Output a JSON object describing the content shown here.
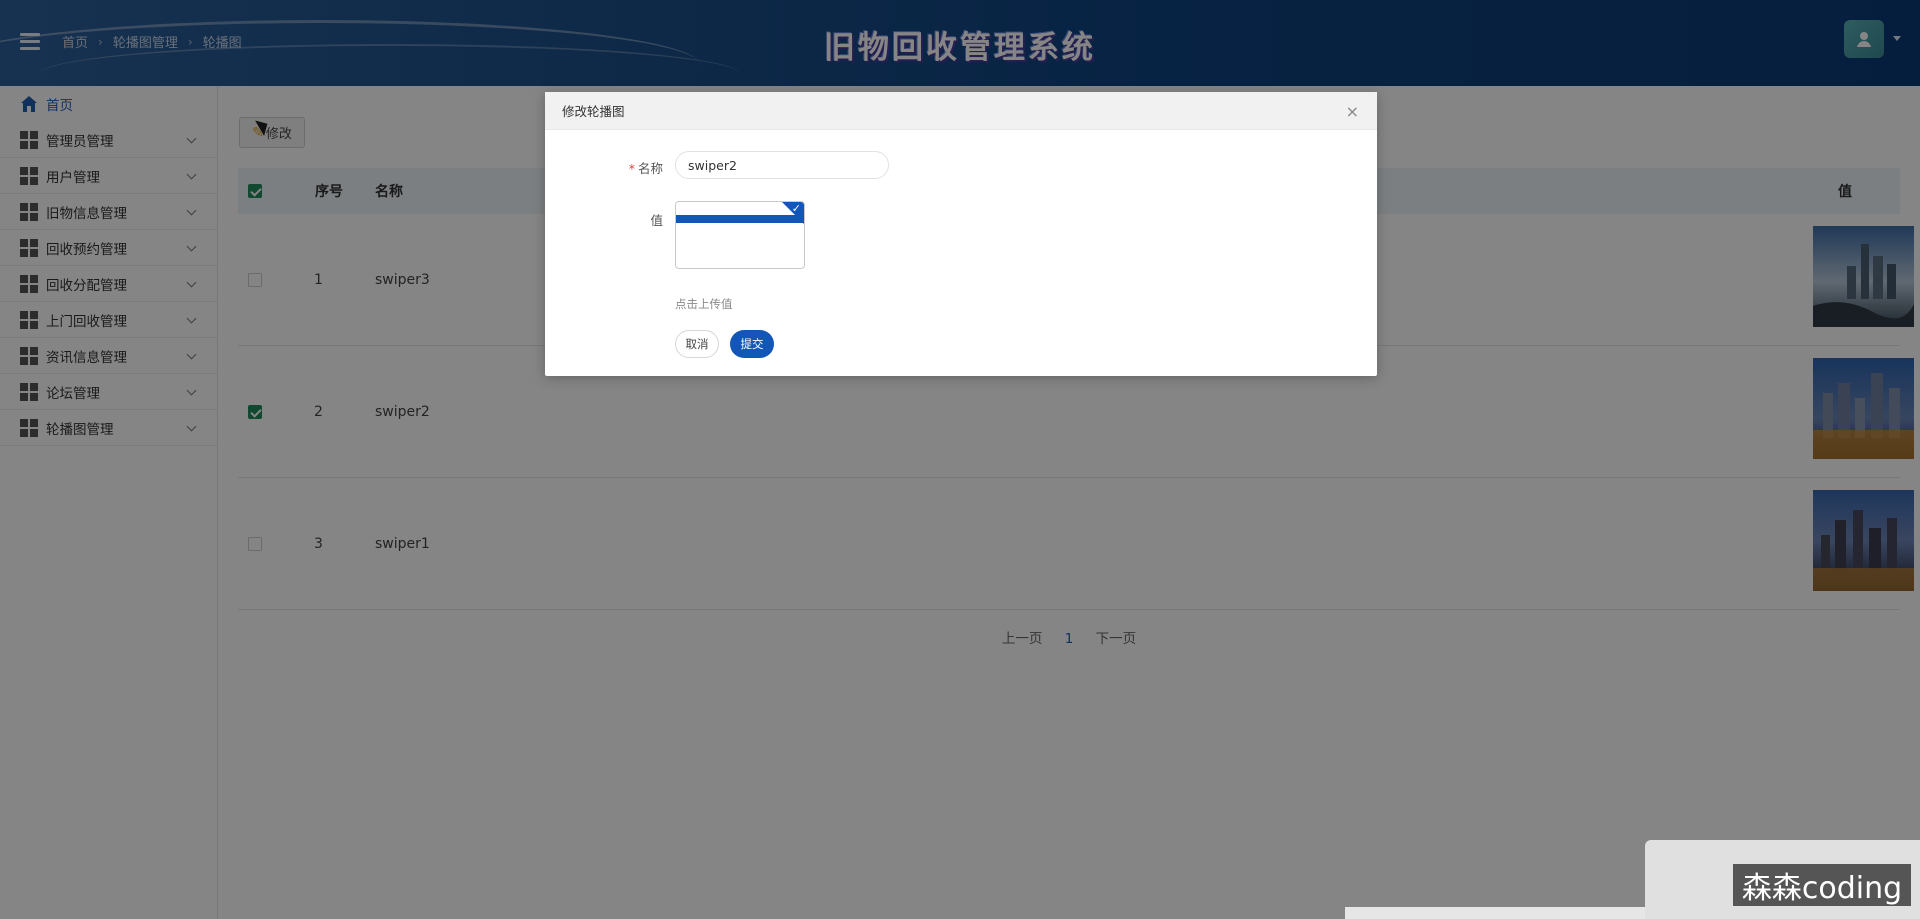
{
  "header": {
    "title": "旧物回收管理系统",
    "breadcrumb": [
      "首页",
      "轮播图管理",
      "轮播图"
    ]
  },
  "sidebar": {
    "items": [
      {
        "label": "首页",
        "icon": "home-icon",
        "expandable": false
      },
      {
        "label": "管理员管理",
        "icon": "grid-icon",
        "expandable": true
      },
      {
        "label": "用户管理",
        "icon": "grid-icon",
        "expandable": true
      },
      {
        "label": "旧物信息管理",
        "icon": "grid-icon",
        "expandable": true
      },
      {
        "label": "回收预约管理",
        "icon": "grid-icon",
        "expandable": true
      },
      {
        "label": "回收分配管理",
        "icon": "grid-icon",
        "expandable": true
      },
      {
        "label": "上门回收管理",
        "icon": "grid-icon",
        "expandable": true
      },
      {
        "label": "资讯信息管理",
        "icon": "grid-icon",
        "expandable": true
      },
      {
        "label": "论坛管理",
        "icon": "grid-icon",
        "expandable": true
      },
      {
        "label": "轮播图管理",
        "icon": "grid-icon",
        "expandable": true
      }
    ]
  },
  "toolbar": {
    "edit_label": "修改"
  },
  "table": {
    "columns": [
      "序号",
      "名称",
      "值"
    ],
    "rows": [
      {
        "index": "1",
        "name": "swiper3",
        "checked": false,
        "image": "city-skyline-day"
      },
      {
        "index": "2",
        "name": "swiper2",
        "checked": true,
        "image": "city-skyline-dusk"
      },
      {
        "index": "3",
        "name": "swiper1",
        "checked": false,
        "image": "city-skyline-night"
      }
    ]
  },
  "pager": {
    "prev": "上一页",
    "current": "1",
    "next": "下一页"
  },
  "modal": {
    "title": "修改轮播图",
    "name_label": "名称",
    "name_value": "swiper2",
    "value_label": "值",
    "upload_hint": "点击上传值",
    "cancel_label": "取消",
    "submit_label": "提交"
  },
  "watermark": "森森coding",
  "colors": {
    "header": "#0f4380",
    "accent": "#1257b8",
    "checked": "#1f8a5c"
  }
}
